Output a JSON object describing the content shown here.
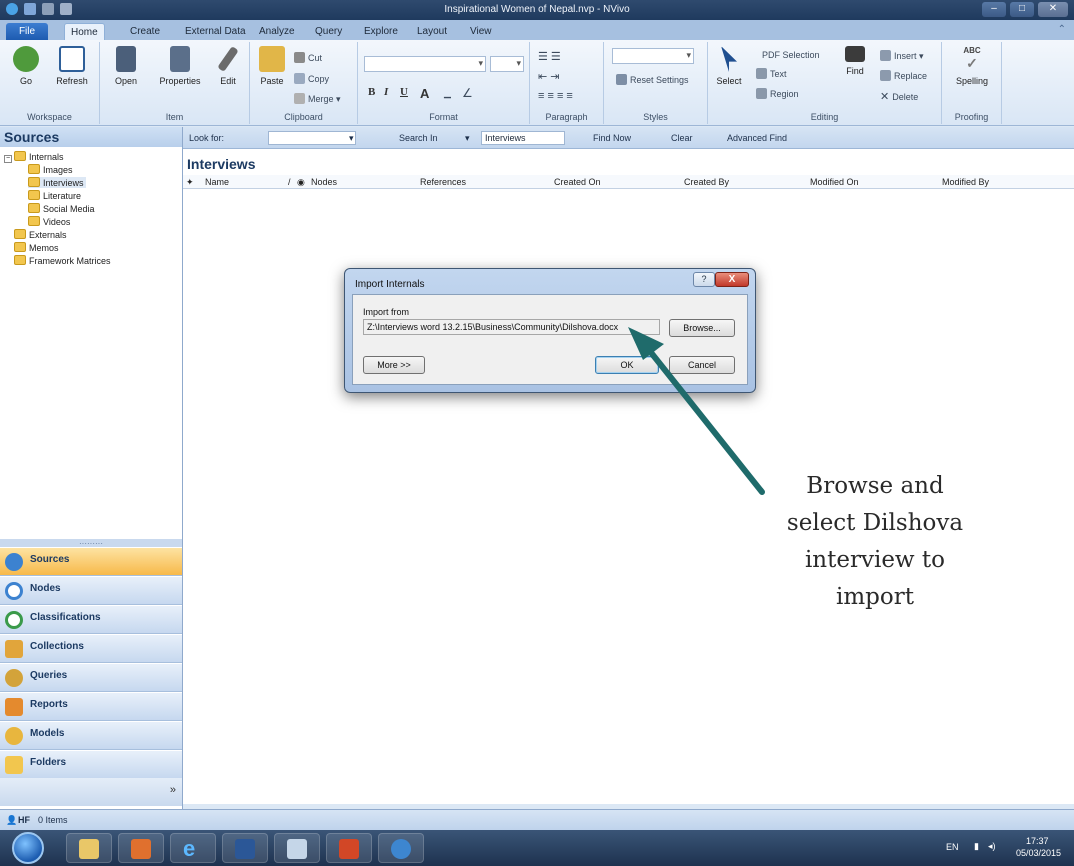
{
  "window": {
    "title": "Inspirational Women of Nepal.nvp - NVivo"
  },
  "tabs": [
    "File",
    "Home",
    "Create",
    "External Data",
    "Analyze",
    "Query",
    "Explore",
    "Layout",
    "View"
  ],
  "ribbon": {
    "workspace": {
      "label": "Workspace",
      "go": "Go",
      "refresh": "Refresh"
    },
    "item": {
      "label": "Item",
      "open": "Open",
      "properties": "Properties",
      "edit": "Edit"
    },
    "clipboard": {
      "label": "Clipboard",
      "paste": "Paste",
      "cut": "Cut",
      "copy": "Copy",
      "merge": "Merge"
    },
    "format": {
      "label": "Format",
      "bold": "B",
      "italic": "I",
      "underline": "U",
      "fontcolor": "A"
    },
    "paragraph": {
      "label": "Paragraph"
    },
    "styles": {
      "label": "Styles",
      "reset": "Reset Settings"
    },
    "editing": {
      "label": "Editing",
      "select": "Select",
      "pdf_selection": "PDF Selection",
      "text": "Text",
      "region": "Region",
      "find": "Find",
      "insert": "Insert",
      "replace": "Replace",
      "delete": "Delete"
    },
    "proofing": {
      "label": "Proofing",
      "spelling": "Spelling",
      "abc": "ABC"
    }
  },
  "sources_panel": {
    "title": "Sources",
    "tree": [
      "Internals",
      "Images",
      "Interviews",
      "Literature",
      "Social Media",
      "Videos",
      "Externals",
      "Memos",
      "Framework Matrices"
    ]
  },
  "nav": [
    "Sources",
    "Nodes",
    "Classifications",
    "Collections",
    "Queries",
    "Reports",
    "Models",
    "Folders"
  ],
  "findbar": {
    "look_for": "Look for:",
    "search_in": "Search In",
    "search_in_value": "Interviews",
    "find_now": "Find Now",
    "clear": "Clear",
    "advanced": "Advanced Find"
  },
  "main": {
    "title": "Interviews",
    "columns": [
      "Name",
      "Nodes",
      "References",
      "Created On",
      "Created By",
      "Modified On",
      "Modified By"
    ]
  },
  "status": {
    "user": "HF",
    "items": "0 Items"
  },
  "dialog": {
    "title": "Import Internals",
    "help": "?",
    "close": "X",
    "import_from": "Import from",
    "path": "Z:\\Interviews word 13.2.15\\Business\\Community\\Dilshova.docx",
    "browse": "Browse...",
    "more": "More >>",
    "ok": "OK",
    "cancel": "Cancel"
  },
  "annotation": [
    "Browse and",
    "select Dilshova",
    "interview to",
    "import"
  ],
  "tray": {
    "lang": "EN",
    "time": "17:37",
    "date": "05/03/2015"
  },
  "colors": {
    "accent": "#1d5bb0",
    "arrow": "#1f6b6b",
    "nav_active": "#f7b94a"
  }
}
